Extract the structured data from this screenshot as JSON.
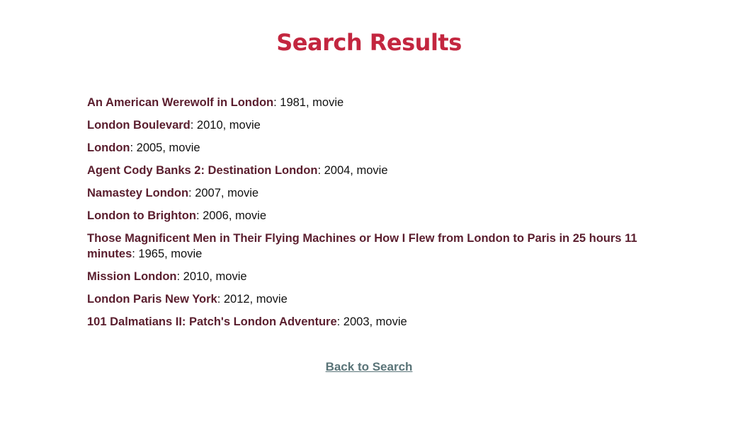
{
  "header": {
    "title": "Search Results"
  },
  "results": [
    {
      "title": "An American Werewolf in London",
      "meta": ": 1981, movie"
    },
    {
      "title": "London Boulevard",
      "meta": ": 2010, movie"
    },
    {
      "title": "London",
      "meta": ": 2005, movie"
    },
    {
      "title": "Agent Cody Banks 2: Destination London",
      "meta": ": 2004, movie"
    },
    {
      "title": "Namastey London",
      "meta": ": 2007, movie"
    },
    {
      "title": "London to Brighton",
      "meta": ": 2006, movie"
    },
    {
      "title": "Those Magnificent Men in Their Flying Machines or How I Flew from London to Paris in 25 hours 11 minutes",
      "meta": ": 1965, movie"
    },
    {
      "title": "Mission London",
      "meta": ": 2010, movie"
    },
    {
      "title": "London Paris New York",
      "meta": ": 2012, movie"
    },
    {
      "title": "101 Dalmatians II: Patch's London Adventure",
      "meta": ": 2003, movie"
    }
  ],
  "footer": {
    "back_label": "Back to Search"
  },
  "colors": {
    "title": "#c3263f",
    "result_title": "#5a1e2e",
    "link": "#5a7478"
  }
}
